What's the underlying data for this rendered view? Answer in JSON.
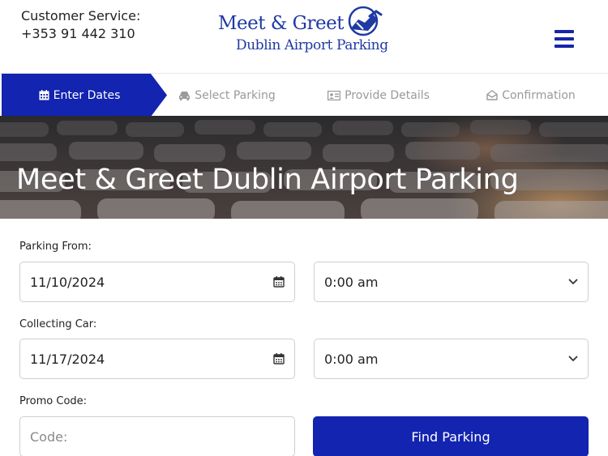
{
  "header": {
    "customer_service_label": "Customer Service:",
    "customer_service_phone": "+353 91 442 310",
    "logo_title": "Meet & Greet",
    "logo_subtitle": "Dublin Airport Parking",
    "menu_icon": "hamburger-icon"
  },
  "steps": [
    {
      "label": "Enter Dates",
      "icon": "calendar-icon",
      "active": true
    },
    {
      "label": "Select Parking",
      "icon": "car-icon",
      "active": false
    },
    {
      "label": "Provide Details",
      "icon": "id-card-icon",
      "active": false
    },
    {
      "label": "Confirmation",
      "icon": "envelope-open-icon",
      "active": false
    }
  ],
  "hero": {
    "title": "Meet & Greet Dublin Airport Parking"
  },
  "form": {
    "parking_from_label": "Parking From:",
    "parking_from_date": "11/10/2024",
    "parking_from_time": "0:00 am",
    "collecting_label": "Collecting Car:",
    "collecting_date": "11/17/2024",
    "collecting_time": "0:00 am",
    "promo_label": "Promo Code:",
    "promo_placeholder": "Code:",
    "find_button": "Find Parking"
  },
  "colors": {
    "brand_blue": "#1324b0",
    "logo_blue": "#1f3aa3",
    "inactive_step": "#9a9a9a"
  }
}
